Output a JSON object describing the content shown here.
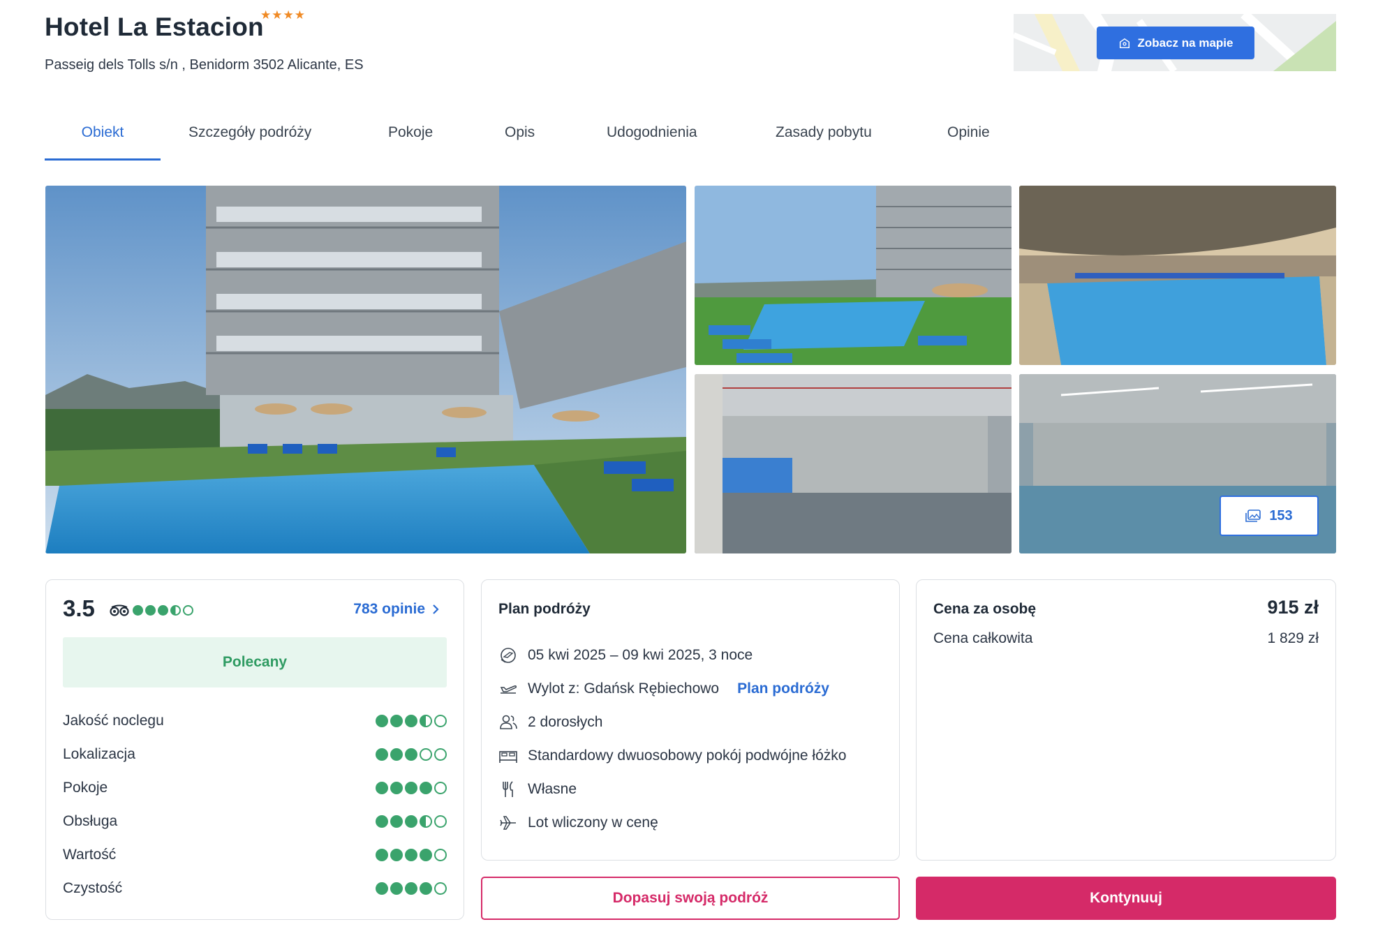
{
  "hotel": {
    "name": "Hotel La Estacion",
    "stars": 4,
    "stars_glyphs": "★★★★",
    "address": "Passeig dels Tolls s/n , Benidorm 3502 Alicante, ES"
  },
  "map": {
    "button_label": "Zobacz na mapie",
    "button_icon": "map-pin-icon"
  },
  "tabs": [
    {
      "label": "Obiekt",
      "active": true
    },
    {
      "label": "Szczegóły podróży",
      "active": false
    },
    {
      "label": "Pokoje",
      "active": false
    },
    {
      "label": "Opis",
      "active": false
    },
    {
      "label": "Udogodnienia",
      "active": false
    },
    {
      "label": "Zasady pobytu",
      "active": false
    },
    {
      "label": "Opinie",
      "active": false
    }
  ],
  "gallery": {
    "photo_count": "153",
    "count_icon": "images-icon"
  },
  "rating": {
    "score": "3.5",
    "source_icon": "tripadvisor-icon",
    "bubbles": 3.5,
    "reviews_link": "783 opinie",
    "badge": "Polecany",
    "categories": [
      {
        "label": "Jakość noclegu",
        "value": 3.5
      },
      {
        "label": "Lokalizacja",
        "value": 3
      },
      {
        "label": "Pokoje",
        "value": 4
      },
      {
        "label": "Obsługa",
        "value": 3.5
      },
      {
        "label": "Wartość",
        "value": 4
      },
      {
        "label": "Czystość",
        "value": 4
      }
    ]
  },
  "plan": {
    "title": "Plan podróży",
    "dates": "05 kwi 2025 – 09 kwi 2025, 3 noce",
    "departure": "Wylot z: Gdańsk Rębiechowo",
    "departure_link": "Plan podróży",
    "travelers": "2 dorosłych",
    "room": "Standardowy dwuosobowy pokój podwójne łóżko",
    "board": "Własne",
    "flight": "Lot wliczony w cenę"
  },
  "price": {
    "per_person_label": "Cena za osobę",
    "per_person_value": "915 zł",
    "total_label": "Cena całkowita",
    "total_value": "1 829 zł"
  },
  "actions": {
    "customize": "Dopasuj swoją podróż",
    "continue": "Kontynuuj"
  },
  "colors": {
    "accent": "#2a6bd3",
    "primary_button": "#d52a68",
    "rating_green": "#3aa36c",
    "badge_bg": "#e7f6ee",
    "star_orange": "#f08a24"
  }
}
